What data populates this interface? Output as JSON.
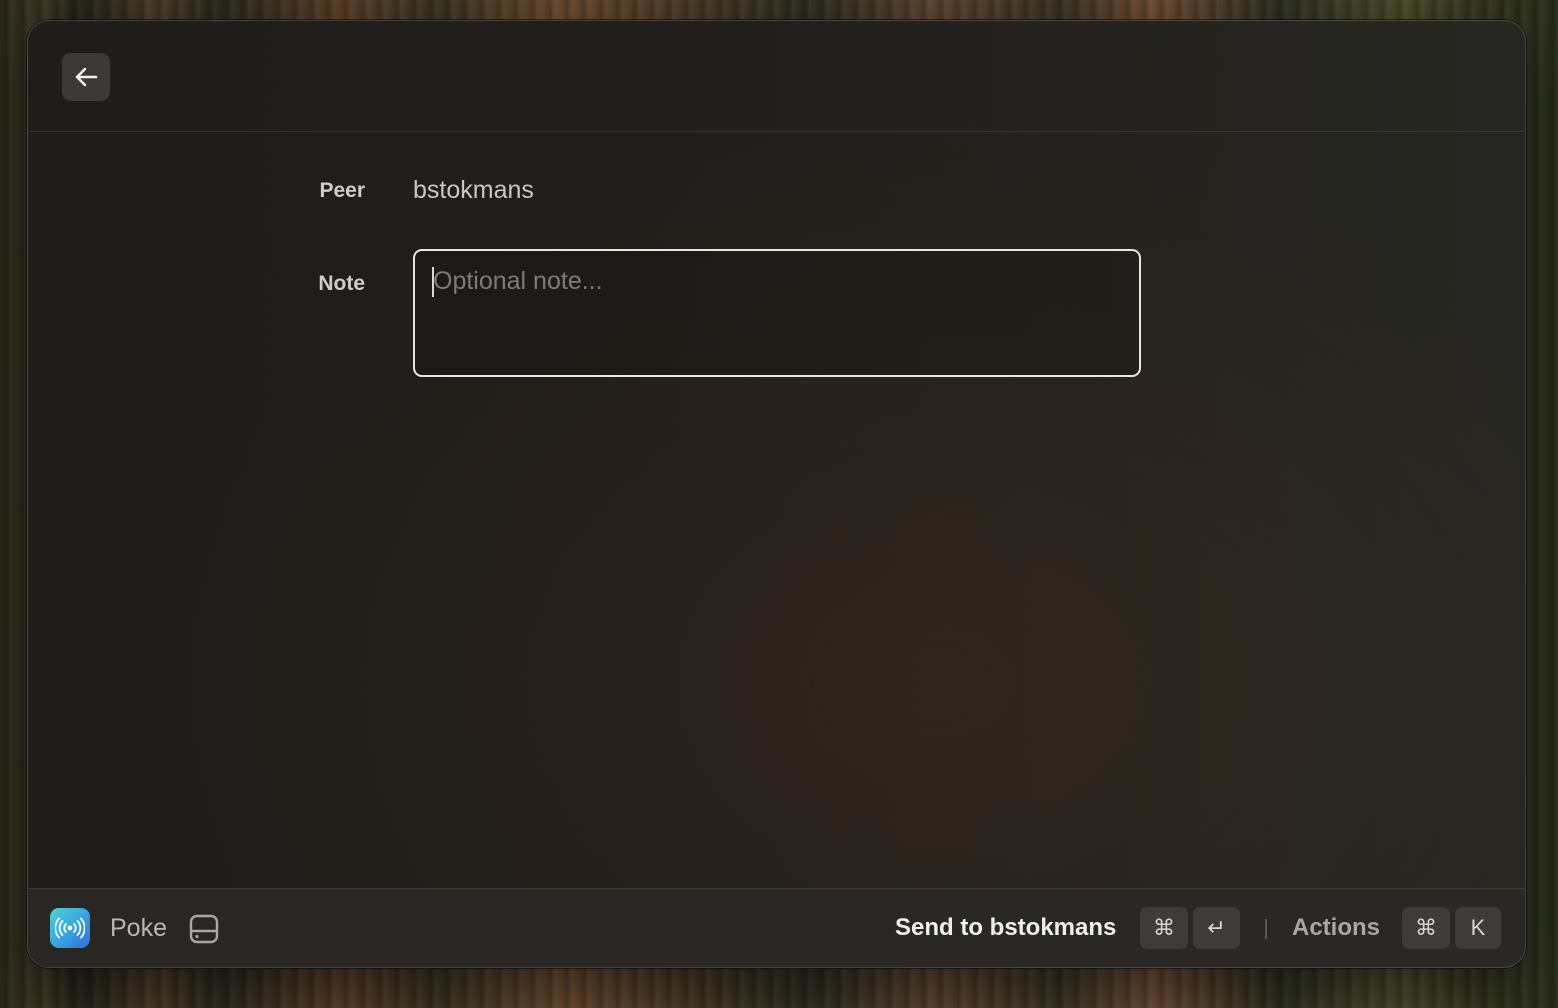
{
  "header": {
    "back_icon": "arrow-left-icon"
  },
  "form": {
    "peer_label": "Peer",
    "peer_value": "bstokmans",
    "note_label": "Note",
    "note_placeholder": "Optional note...",
    "note_value": ""
  },
  "footer": {
    "app_icon": "broadcast-icon",
    "app_name": "Poke",
    "drive_icon": "hard-drive-icon",
    "primary_action_label": "Send to bstokmans",
    "primary_shortcut": [
      "⌘",
      "↵"
    ],
    "actions_label": "Actions",
    "actions_shortcut": [
      "⌘",
      "K"
    ]
  },
  "colors": {
    "accent_focus_border": "#e8e6e2",
    "app_icon_gradient": [
      "#4fd2d6",
      "#2d6fd8"
    ],
    "window_background": "#201e1b"
  }
}
